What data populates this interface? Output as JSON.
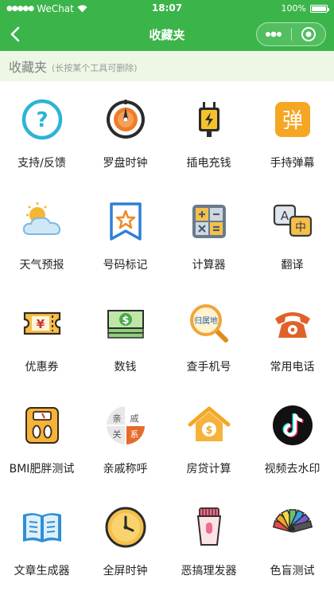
{
  "status_bar": {
    "carrier": "WeChat",
    "time": "18:07",
    "battery": "100%",
    "battery_level": 1.0
  },
  "nav": {
    "title": "收藏夹",
    "back_icon": "chevron-left-icon",
    "more_icon": "more-dots-icon",
    "close_icon": "target-circle-icon"
  },
  "section": {
    "title": "收藏夹",
    "hint": "(长按某个工具可删除)"
  },
  "colors": {
    "brand_green": "#3bb54a",
    "header_bg": "#eef7e6"
  },
  "tools": [
    {
      "label": "支持/反馈",
      "icon": "help-question-icon"
    },
    {
      "label": "罗盘时钟",
      "icon": "compass-clock-icon"
    },
    {
      "label": "插电充钱",
      "icon": "power-plug-icon"
    },
    {
      "label": "手持弹幕",
      "icon": "danmaku-icon",
      "glyph": "弹"
    },
    {
      "label": "天气预报",
      "icon": "weather-icon"
    },
    {
      "label": "号码标记",
      "icon": "star-bookmark-icon"
    },
    {
      "label": "计算器",
      "icon": "calculator-icon"
    },
    {
      "label": "翻译",
      "icon": "translate-icon",
      "glyph_a": "A",
      "glyph_b": "中"
    },
    {
      "label": "优惠券",
      "icon": "coupon-icon",
      "glyph": "¥"
    },
    {
      "label": "数钱",
      "icon": "money-icon",
      "glyph": "$"
    },
    {
      "label": "查手机号",
      "icon": "phone-lookup-icon",
      "glyph": "归属地"
    },
    {
      "label": "常用电话",
      "icon": "telephone-icon"
    },
    {
      "label": "BMI肥胖测试",
      "icon": "scale-icon"
    },
    {
      "label": "亲戚称呼",
      "icon": "relatives-icon",
      "glyphs": [
        "亲",
        "戚",
        "关",
        "系"
      ]
    },
    {
      "label": "房贷计算",
      "icon": "house-loan-icon",
      "glyph": "$"
    },
    {
      "label": "视频去水印",
      "icon": "tiktok-icon"
    },
    {
      "label": "文章生成器",
      "icon": "book-icon"
    },
    {
      "label": "全屏时钟",
      "icon": "fullscreen-clock-icon"
    },
    {
      "label": "恶搞理发器",
      "icon": "hair-clipper-icon"
    },
    {
      "label": "色盲测试",
      "icon": "color-palette-icon"
    }
  ]
}
